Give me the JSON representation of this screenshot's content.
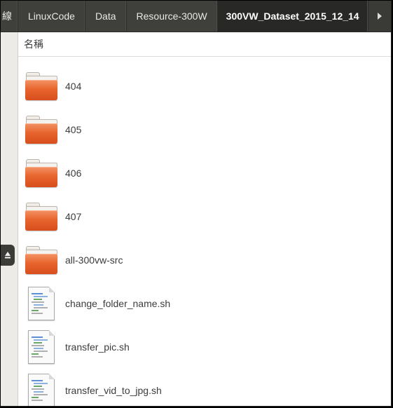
{
  "breadcrumbs": [
    {
      "label": "線",
      "partial": true
    },
    {
      "label": "LinuxCode"
    },
    {
      "label": "Data"
    },
    {
      "label": "Resource-300W"
    },
    {
      "label": "300VW_Dataset_2015_12_14",
      "active": true
    }
  ],
  "scroll_right_icon": "triangle-right-icon",
  "column_header": "名稱",
  "colors": {
    "folder": "#e8652e",
    "pathbar": "#3f3f3c",
    "active_crumb": "#282826"
  },
  "items": [
    {
      "name": "404",
      "type": "folder"
    },
    {
      "name": "405",
      "type": "folder"
    },
    {
      "name": "406",
      "type": "folder"
    },
    {
      "name": "407",
      "type": "folder"
    },
    {
      "name": "all-300vw-src",
      "type": "folder"
    },
    {
      "name": "change_folder_name.sh",
      "type": "script"
    },
    {
      "name": "transfer_pic.sh",
      "type": "script"
    },
    {
      "name": "transfer_vid_to_jpg.sh",
      "type": "script"
    }
  ]
}
